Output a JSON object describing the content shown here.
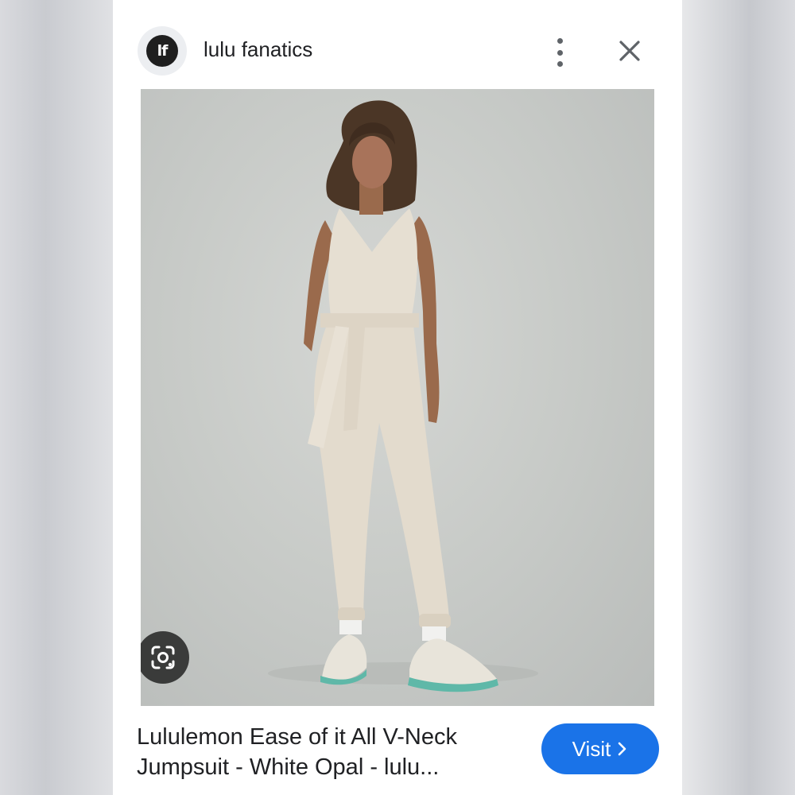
{
  "header": {
    "avatar_initials": "lf",
    "site_name": "lulu fanatics"
  },
  "image": {
    "alt": "Lululemon Ease of it All V-Neck Jumpsuit - White Opal - lulu..."
  },
  "footer": {
    "title": "Lululemon Ease of it All V-Neck Jumpsuit - White Opal - lulu...",
    "visit_label": "Visit"
  },
  "colors": {
    "accent": "#1a73e8",
    "photo_bg": "#c6c9c6",
    "jumpsuit": "#e6dfd2"
  },
  "icons": {
    "more": "more-vert-icon",
    "close": "close-icon",
    "lens": "google-lens-icon",
    "chevron": "chevron-right-icon"
  }
}
